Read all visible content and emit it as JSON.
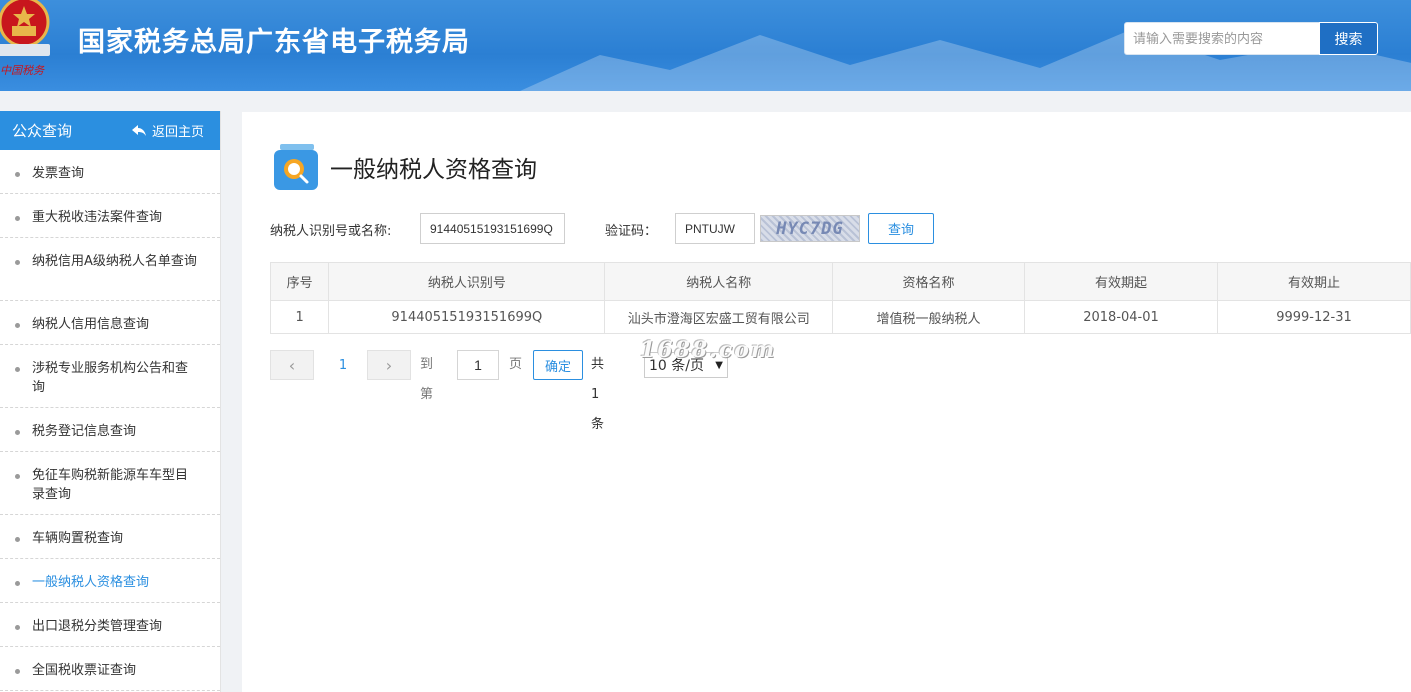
{
  "header": {
    "site_title": "国家税务总局广东省电子税务局",
    "emblem_text": "中国税务",
    "search_placeholder": "请输入需要搜索的内容",
    "search_button": "搜索"
  },
  "sidebar": {
    "title": "公众查询",
    "back_label": "返回主页",
    "items": [
      {
        "label": "发票查询"
      },
      {
        "label": "重大税收违法案件查询"
      },
      {
        "label": "纳税信用A级纳税人名单查询"
      },
      {
        "label": "纳税人信用信息查询"
      },
      {
        "label": "涉税专业服务机构公告和查询"
      },
      {
        "label": "税务登记信息查询"
      },
      {
        "label": "免征车购税新能源车车型目录查询"
      },
      {
        "label": "车辆购置税查询"
      },
      {
        "label": "一般纳税人资格查询"
      },
      {
        "label": "出口退税分类管理查询"
      },
      {
        "label": "全国税收票证查询"
      }
    ],
    "active_item": "一般纳税人资格查询"
  },
  "main": {
    "page_title": "一般纳税人资格查询",
    "form": {
      "taxid_label": "纳税人识别号或名称:",
      "taxid_value": "91440515193151699Q",
      "captcha_label": "验证码：",
      "captcha_value": "PNTUJW",
      "captcha_image_text": "HYC7DG",
      "query_button": "查询"
    },
    "table": {
      "headers": [
        "序号",
        "纳税人识别号",
        "纳税人名称",
        "资格名称",
        "有效期起",
        "有效期止"
      ],
      "rows": [
        [
          "1",
          "91440515193151699Q",
          "汕头市澄海区宏盛工贸有限公司",
          "增值税一般纳税人",
          "2018-04-01",
          "9999-12-31"
        ]
      ]
    },
    "pagination": {
      "current_page": "1",
      "goto_label": "到第",
      "goto_value": "1",
      "page_unit": "页",
      "confirm_button": "确定",
      "total_text": "共 1 条",
      "page_size": "10 条/页"
    }
  },
  "watermark": "1688.com",
  "colors": {
    "header_blue": "#2b7fd3",
    "accent_blue": "#2b8fe0",
    "sidebar_head": "#2b8fe0"
  }
}
